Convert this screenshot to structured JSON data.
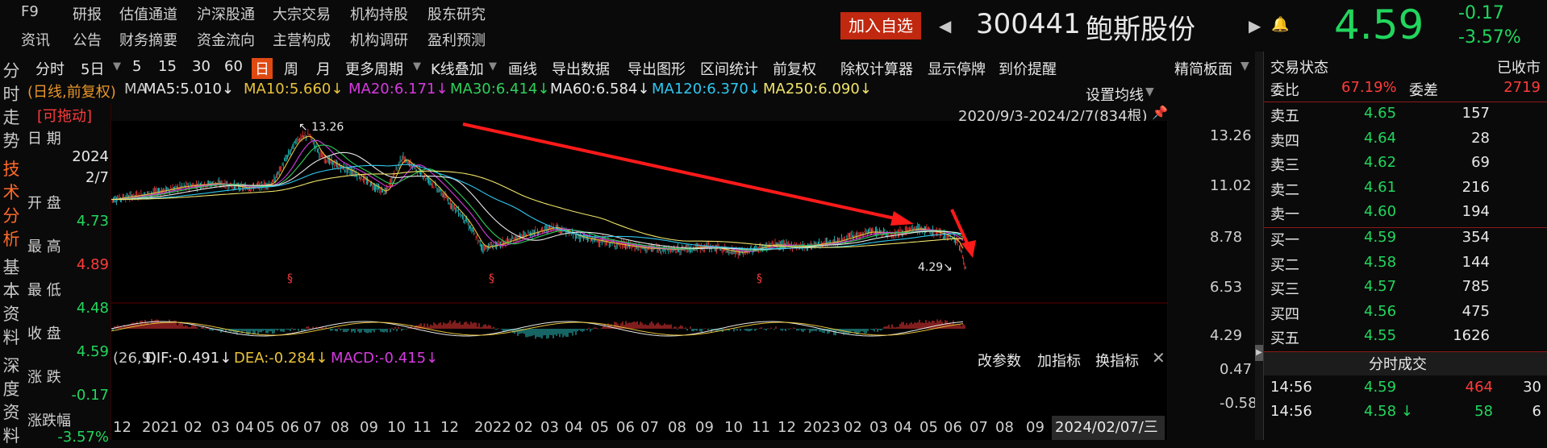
{
  "menu_row1": [
    "F9",
    "研报",
    "估值通道",
    "沪深股通",
    "大宗交易",
    "机构持股",
    "股东研究"
  ],
  "menu_row2": [
    "资讯",
    "公告",
    "财务摘要",
    "资金流向",
    "主营构成",
    "机构调研",
    "盈利预测"
  ],
  "header": {
    "add_watch": "加入自选",
    "code": "300441",
    "name": "鲍斯股份",
    "price": "4.59",
    "change": "-0.17",
    "change_pct": "-3.57%"
  },
  "side_tabs": [
    "分时走势",
    "技术分析",
    "基本资料",
    "深度资料"
  ],
  "toolbar": [
    "分时",
    "5日",
    "5",
    "15",
    "30",
    "60",
    "日",
    "周",
    "月",
    "更多周期",
    "K线叠加",
    "画线",
    "导出数据",
    "导出图形",
    "区间统计",
    "前复权",
    "除权计算器",
    "显示停牌",
    "到价提醒"
  ],
  "mode_label": "精简板面",
  "chart_tag": "(日线,前复权)",
  "ma_items": [
    {
      "label": "MA",
      "color": "#c8c8c8"
    },
    {
      "label": "MA5:5.010↓",
      "color": "#e8e8e8"
    },
    {
      "label": "MA10:5.660↓",
      "color": "#e8c23a"
    },
    {
      "label": "MA20:6.171↓",
      "color": "#d63ae0"
    },
    {
      "label": "MA30:6.414↓",
      "color": "#2ed05a"
    },
    {
      "label": "MA60:6.584↓",
      "color": "#e8e8e8"
    },
    {
      "label": "MA120:6.370↓",
      "color": "#2ec8f0"
    },
    {
      "label": "MA250:6.090↓",
      "color": "#f0e46a"
    }
  ],
  "set_ma": "设置均线",
  "date_range": "2020/9/3-2024/2/7(834根)",
  "info_panel": {
    "drag": "[可拖动]",
    "date_label": "日  期",
    "year": "2024",
    "md": "2/7",
    "open_label": "开  盘",
    "open": "4.73",
    "high_label": "最  高",
    "high": "4.89",
    "low_label": "最  低",
    "low": "4.48",
    "close_label": "收  盘",
    "close": "4.59",
    "chg_label": "涨  跌",
    "chg": "-0.17",
    "pct_label": "涨跌幅",
    "pct": "-3.57%"
  },
  "price_axis": [
    "13.26",
    "11.02",
    "8.78",
    "6.53",
    "4.29"
  ],
  "macd_axis": [
    "0.47",
    "-0.58"
  ],
  "macd": {
    "prefix": "(26,9)",
    "dif": "DIF:-0.491↓",
    "dea": "DEA:-0.284↓",
    "macd": "MACD:-0.415↓",
    "btns": [
      "改参数",
      "加指标",
      "换指标"
    ]
  },
  "annotations": {
    "high": "13.26",
    "low": "4.29"
  },
  "x_axis": [
    "12",
    "2021",
    "02",
    "03",
    "04",
    "05",
    "06",
    "07",
    "08",
    "09",
    "10",
    "11",
    "12",
    "2022",
    "02",
    "03",
    "04",
    "05",
    "06",
    "07",
    "08",
    "09",
    "10",
    "11",
    "12",
    "2023",
    "02",
    "03",
    "04",
    "05",
    "06",
    "07",
    "08",
    "09"
  ],
  "x_cursor": "2024/02/07/三",
  "orderbook": {
    "status_label": "交易状态",
    "status": "已收市",
    "wb_label": "委比",
    "wb": "67.19%",
    "wc_label": "委差",
    "wc": "2719",
    "asks": [
      {
        "l": "卖五",
        "p": "4.65",
        "v": "157"
      },
      {
        "l": "卖四",
        "p": "4.64",
        "v": "28"
      },
      {
        "l": "卖三",
        "p": "4.62",
        "v": "69"
      },
      {
        "l": "卖二",
        "p": "4.61",
        "v": "216"
      },
      {
        "l": "卖一",
        "p": "4.60",
        "v": "194"
      }
    ],
    "bids": [
      {
        "l": "买一",
        "p": "4.59",
        "v": "354"
      },
      {
        "l": "买二",
        "p": "4.58",
        "v": "144"
      },
      {
        "l": "买三",
        "p": "4.57",
        "v": "785"
      },
      {
        "l": "买四",
        "p": "4.56",
        "v": "475"
      },
      {
        "l": "买五",
        "p": "4.55",
        "v": "1626"
      }
    ],
    "trades_title": "分时成交",
    "trades": [
      {
        "t": "14:56",
        "p": "4.59",
        "v": "464",
        "n": "30"
      },
      {
        "t": "14:56",
        "p": "4.58 ↓",
        "v": "58",
        "n": "6"
      }
    ]
  },
  "colors": {
    "up": "#ff3b3b",
    "down": "#22d65d",
    "accent": "#c0280f"
  }
}
